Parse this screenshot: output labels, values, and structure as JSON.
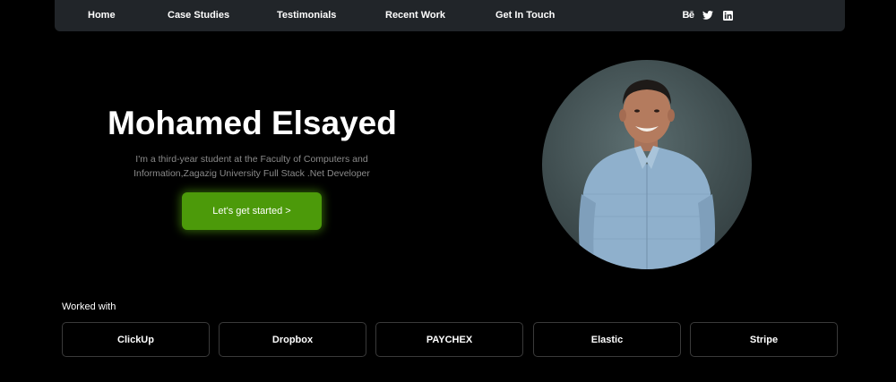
{
  "nav": {
    "links": [
      "Home",
      "Case Studies",
      "Testimonials",
      "Recent Work",
      "Get In Touch"
    ],
    "social": {
      "behance_label": "Bē",
      "icons": [
        "behance-icon",
        "twitter-icon",
        "linkedin-icon"
      ]
    }
  },
  "hero": {
    "name": "Mohamed Elsayed",
    "description": "I'm a third-year student at the Faculty of Computers and Information,Zagazig University Full Stack .Net Developer",
    "cta_label": "Let's get started >"
  },
  "worked_with": {
    "label": "Worked with",
    "brands": [
      "ClickUp",
      "Dropbox",
      "PAYCHEX",
      "Elastic",
      "Stripe"
    ]
  },
  "colors": {
    "background": "#000000",
    "navbar": "#212529",
    "accent": "#4c9a0a",
    "muted_text": "#8a8a8a"
  }
}
